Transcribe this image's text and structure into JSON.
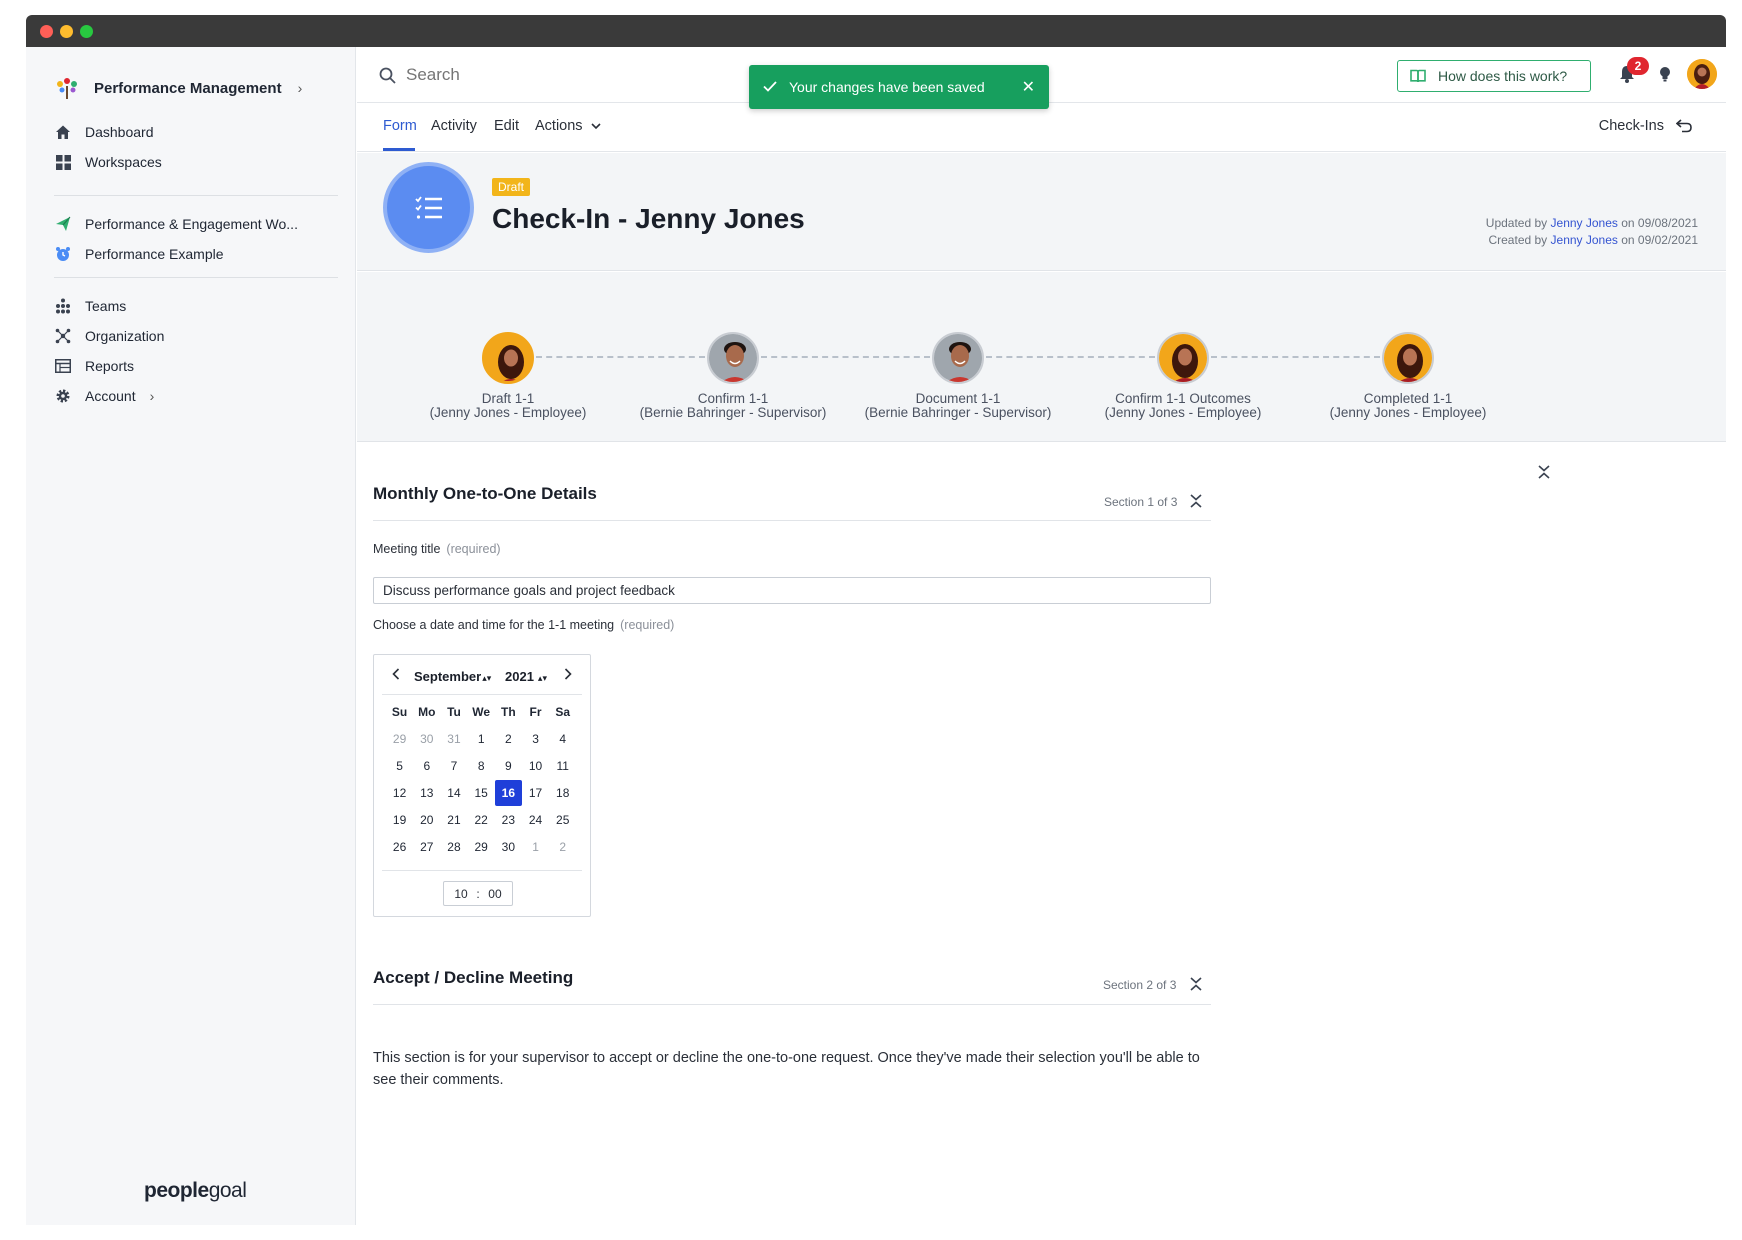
{
  "sidebar": {
    "brand": "Performance Management",
    "primary": [
      {
        "label": "Dashboard",
        "icon": "home-icon"
      },
      {
        "label": "Workspaces",
        "icon": "grid-icon"
      }
    ],
    "workspaces": [
      {
        "label": "Performance & Engagement Wo...",
        "icon": "paper-plane-icon",
        "color": "#2fae6f"
      },
      {
        "label": "Performance Example",
        "icon": "alarm-clock-icon",
        "color": "#4a8cf5"
      }
    ],
    "secondary": [
      {
        "label": "Teams",
        "icon": "teams-icon"
      },
      {
        "label": "Organization",
        "icon": "organization-icon"
      },
      {
        "label": "Reports",
        "icon": "reports-icon"
      },
      {
        "label": "Account",
        "icon": "gear-icon"
      }
    ],
    "footer_logo_bold": "people",
    "footer_logo_light": "goal"
  },
  "topbar": {
    "search_placeholder": "Search",
    "toast": "Your changes have been saved",
    "help_label": "How does this work?",
    "notification_count": "2"
  },
  "tabs": {
    "items": [
      "Form",
      "Activity",
      "Edit",
      "Actions"
    ],
    "active": "Form",
    "right_link": "Check-Ins"
  },
  "header": {
    "status": "Draft",
    "title": "Check-In - Jenny  Jones",
    "updated_prefix": "Updated by",
    "updated_user": "Jenny Jones",
    "updated_suffix": "on 09/08/2021",
    "created_prefix": "Created by",
    "created_user": "Jenny Jones",
    "created_suffix": "on 09/02/2021"
  },
  "workflow": [
    {
      "line1": "Draft 1-1",
      "line2": "(Jenny Jones - Employee)",
      "person": "female",
      "active": true
    },
    {
      "line1": "Confirm 1-1",
      "line2": "(Bernie Bahringer - Supervisor)",
      "person": "male",
      "active": false
    },
    {
      "line1": "Document 1-1",
      "line2": "(Bernie Bahringer - Supervisor)",
      "person": "male",
      "active": false
    },
    {
      "line1": "Confirm 1-1 Outcomes",
      "line2": "(Jenny Jones - Employee)",
      "person": "female",
      "active": false
    },
    {
      "line1": "Completed 1-1",
      "line2": "(Jenny Jones - Employee)",
      "person": "female",
      "active": false
    }
  ],
  "section1": {
    "title": "Monthly One-to-One Details",
    "count": "Section 1 of 3",
    "meeting_title_label": "Meeting title",
    "required": "(required)",
    "meeting_title_value": "Discuss performance goals and project feedback",
    "date_label": "Choose a date and time for the 1-1 meeting"
  },
  "calendar": {
    "month": "September",
    "year": "2021",
    "weekdays": [
      "Su",
      "Mo",
      "Tu",
      "We",
      "Th",
      "Fr",
      "Sa"
    ],
    "weeks": [
      [
        {
          "d": "29",
          "m": true
        },
        {
          "d": "30",
          "m": true
        },
        {
          "d": "31",
          "m": true
        },
        {
          "d": "1"
        },
        {
          "d": "2"
        },
        {
          "d": "3"
        },
        {
          "d": "4"
        }
      ],
      [
        {
          "d": "5"
        },
        {
          "d": "6"
        },
        {
          "d": "7"
        },
        {
          "d": "8"
        },
        {
          "d": "9"
        },
        {
          "d": "10"
        },
        {
          "d": "11"
        }
      ],
      [
        {
          "d": "12"
        },
        {
          "d": "13"
        },
        {
          "d": "14"
        },
        {
          "d": "15"
        },
        {
          "d": "16",
          "s": true
        },
        {
          "d": "17"
        },
        {
          "d": "18"
        }
      ],
      [
        {
          "d": "19"
        },
        {
          "d": "20"
        },
        {
          "d": "21"
        },
        {
          "d": "22"
        },
        {
          "d": "23"
        },
        {
          "d": "24"
        },
        {
          "d": "25"
        }
      ],
      [
        {
          "d": "26"
        },
        {
          "d": "27"
        },
        {
          "d": "28"
        },
        {
          "d": "29"
        },
        {
          "d": "30"
        },
        {
          "d": "1",
          "m": true
        },
        {
          "d": "2",
          "m": true
        }
      ]
    ],
    "hour": "10",
    "separator": ":",
    "minute": "00"
  },
  "section2": {
    "title": "Accept / Decline Meeting",
    "count": "Section 2 of 3",
    "text": "This section is for your supervisor to accept or decline the one-to-one request. Once they've made their selection you'll be able to see their comments."
  }
}
